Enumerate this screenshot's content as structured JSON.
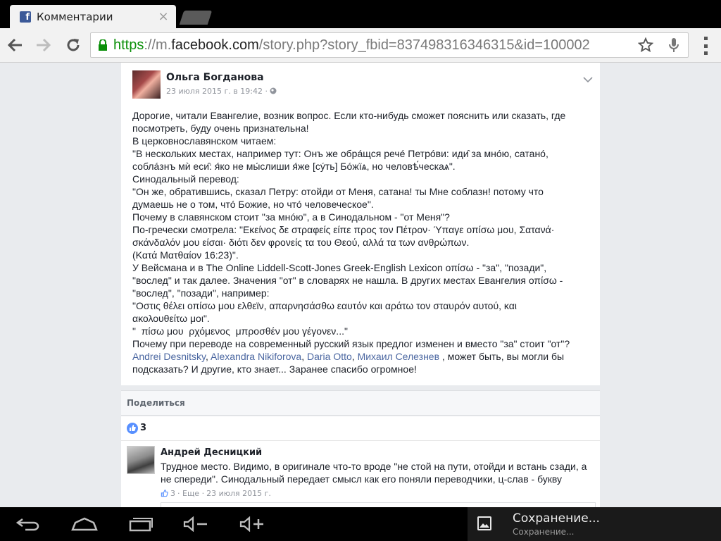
{
  "browser": {
    "tab_title": "Комментарии",
    "tab_close": "×",
    "favicon_letter": "f",
    "url_scheme": "https",
    "url_sep": "://",
    "url_sub": "m.",
    "url_host": "facebook.com",
    "url_path": "/story.php?story_fbid=837498316346315&id=100002"
  },
  "post": {
    "author": "Ольга Богданова",
    "time": "23 июля 2015 г. в 19:42 · ",
    "lines": [
      "Дорогие, читали Евангелие, возник вопрос. Если кто-нибудь сможет пояснить или сказать, где",
      "посмотреть, буду очень признательна!",
      "В церковнославянском читаем:",
      "\"В нескольких местах, например тут: Онъ же обрáщся речé Петрóви: иди̑ за мнóю, сатанó,",
      "соблáзнъ мѝ еси̑: я́ко не мы́слиши я́же [сýть] Бóжїѧ, но человѣ́ческаѧ\".",
      "Синодальный перевод:",
      "\"Он же, обратившись, сказал Петру: отойди от Меня, сатана! ты Мне соблазн! потому что",
      "думаешь не о том, что́ Божие, но что́ человеческое\".",
      "Почему в славянском стоит \"за мнóю\", а в Синодальном - \"от Меня\"?",
      "По-гречески смотрела: \"Εκείνος δε στραφείς είπε προς τον Πέτρον· Ύπαγε οπίσω μου, Σατανά·",
      "σκάνδαλόν μου είσαι· διότι δεν φρονείς τα του Θεού, αλλά τα των ανθρώπων.",
      "(Κατά Ματθαίον 16:23)\".",
      "У Вейсмана и в The Online Liddell-Scott-Jones Greek-English Lexicon οπίσω - \"за\", \"позади\",",
      "\"вослед\" и так далее. Значения \"от\" в словарях не нашла. В других местах Евангелия οπίσω -",
      "\"вослед\", \"позади\", например:",
      "\"Οστις θέλει οπίσω μου ελθεϊν, απαρνησάσθω εαυτόν και αράτω τον σταυρόν αυτού, και",
      "ακολουθείτω μοι\".",
      "\"  πίσω μου  ρχόμενος  μπροσθέν μου γέγονεν...\"",
      "Почему при переводе на современный русский язык предлог изменен и вместо \"за\" стоит \"от\"?"
    ],
    "mentions": [
      "Andrei Desnitsky",
      "Alexandra Nikiforova",
      "Daria Otto",
      "Михаил Селезнев"
    ],
    "mention_sep": ", ",
    "mention_tail": " , может быть, вы могли бы",
    "last_line": "подсказать? И другие, кто знает... Заранее спасибо огромное!"
  },
  "share": {
    "label": "Поделиться"
  },
  "likes": {
    "count": "3"
  },
  "comment": {
    "author": "Андрей Десницкий",
    "text": "Трудное место. Видимо, в оригинале что-то вроде \"не стой на пути, отойди и встань сзади, а не спереди\". Синодальный передает смысл как его поняли переводчики, ц-слав - букву",
    "like_count": "3",
    "more": "· Еще ·",
    "date": "23 июля 2015 г."
  },
  "notification": {
    "title": "Сохранение...",
    "subtitle": "Сохранение..."
  },
  "colors": {
    "facebook_blue": "#3b5998",
    "link_blue": "#4b67a1",
    "https_green": "#0a8f08",
    "like_blue": "#5890ff"
  },
  "icons": [
    "back-arrow-icon",
    "forward-arrow-icon",
    "reload-icon",
    "lock-icon",
    "star-icon",
    "microphone-icon",
    "menu-icon",
    "chevron-down-icon",
    "globe-icon",
    "thumbs-up-icon",
    "android-back-icon",
    "android-home-icon",
    "android-recents-icon",
    "volume-down-icon",
    "volume-up-icon",
    "image-icon"
  ]
}
